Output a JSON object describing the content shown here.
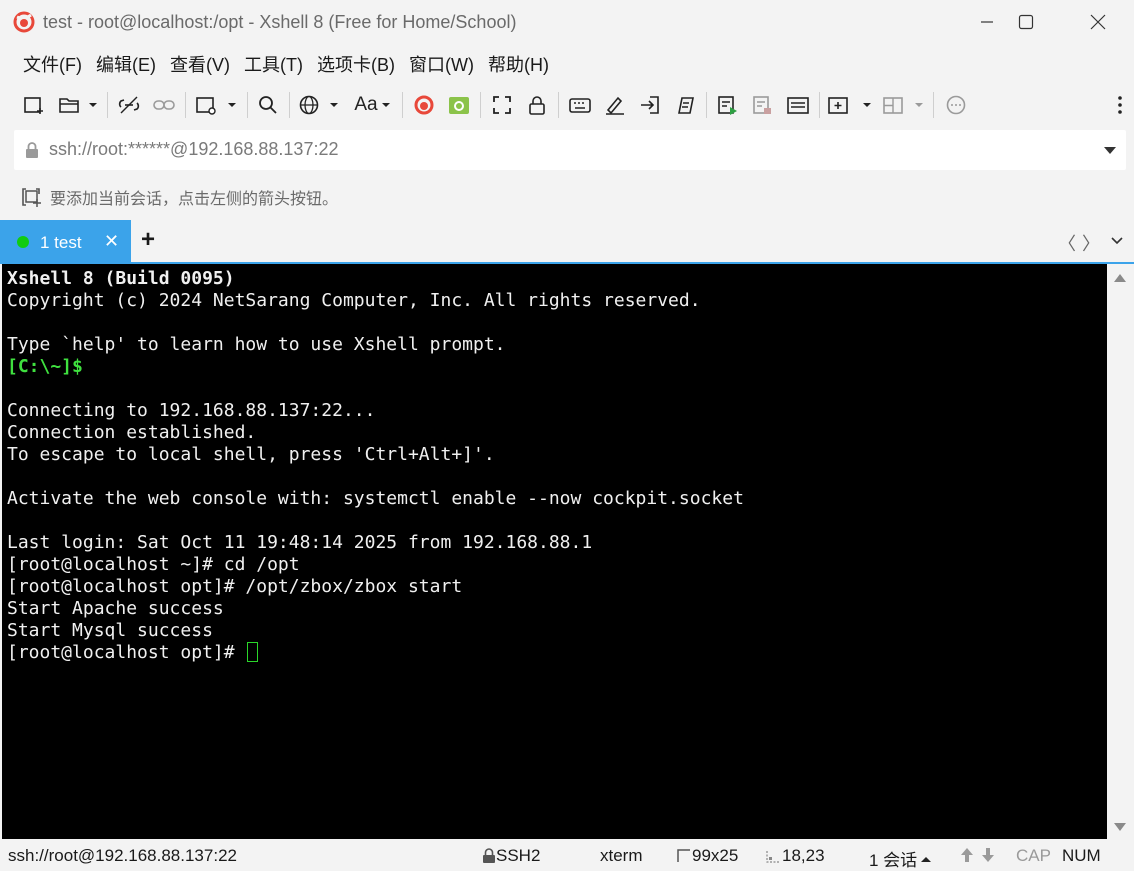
{
  "window": {
    "title": "test - root@localhost:/opt - Xshell 8 (Free for Home/School)",
    "accent_color": "#3ba3ea",
    "app_icon": "xshell-logo-icon"
  },
  "menu": [
    {
      "label": "文件(F)"
    },
    {
      "label": "编辑(E)"
    },
    {
      "label": "查看(V)"
    },
    {
      "label": "工具(T)"
    },
    {
      "label": "选项卡(B)"
    },
    {
      "label": "窗口(W)"
    },
    {
      "label": "帮助(H)"
    }
  ],
  "toolbar": {
    "font_label": "Aa"
  },
  "address": {
    "value": "ssh://root:******@192.168.88.137:22"
  },
  "hint": {
    "text": "要添加当前会话，点击左侧的箭头按钮。"
  },
  "tabs": [
    {
      "label": "1 test",
      "status_color": "#11cc11",
      "close": "✕"
    }
  ],
  "tabbar": {
    "add": "+",
    "prev": "〈",
    "next": "〉",
    "menu": "⌄"
  },
  "terminal": {
    "lines": [
      {
        "text": "Xshell 8 (Build 0095)",
        "style": "bold"
      },
      {
        "text": "Copyright (c) 2024 NetSarang Computer, Inc. All rights reserved.",
        "style": ""
      },
      {
        "text": "",
        "style": ""
      },
      {
        "text": "Type `help' to learn how to use Xshell prompt.",
        "style": ""
      },
      {
        "text": "[C:\\~]$",
        "style": "green"
      },
      {
        "text": "",
        "style": ""
      },
      {
        "text": "Connecting to 192.168.88.137:22...",
        "style": ""
      },
      {
        "text": "Connection established.",
        "style": ""
      },
      {
        "text": "To escape to local shell, press 'Ctrl+Alt+]'.",
        "style": ""
      },
      {
        "text": "",
        "style": ""
      },
      {
        "text": "Activate the web console with: systemctl enable --now cockpit.socket",
        "style": ""
      },
      {
        "text": "",
        "style": ""
      },
      {
        "text": "Last login: Sat Oct 11 19:48:14 2025 from 192.168.88.1",
        "style": ""
      },
      {
        "text": "[root@localhost ~]# cd /opt",
        "style": ""
      },
      {
        "text": "[root@localhost opt]# /opt/zbox/zbox start",
        "style": ""
      },
      {
        "text": "Start Apache success",
        "style": ""
      },
      {
        "text": "Start Mysql success",
        "style": ""
      }
    ],
    "prompt": "[root@localhost opt]# "
  },
  "status": {
    "connection": "ssh://root@192.168.88.137:22",
    "protocol": "SSH2",
    "terminal_type": "xterm",
    "size": "99x25",
    "cursor_pos": "18,23",
    "sessions": "1 会话",
    "cap": "CAP",
    "num": "NUM"
  }
}
